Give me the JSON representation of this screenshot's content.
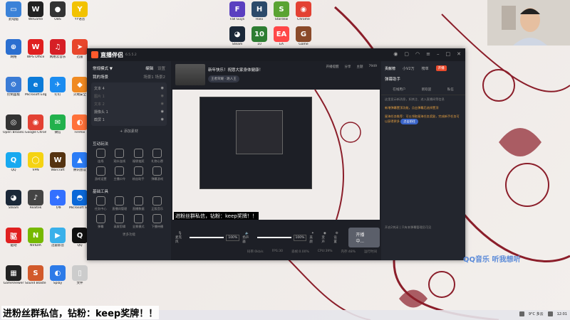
{
  "desktop": {
    "left_icons": [
      {
        "label": "此电脑",
        "color": "#3b82d8",
        "glyph": "▭"
      },
      {
        "label": "WeGame",
        "color": "#222",
        "glyph": "W"
      },
      {
        "label": "OBS",
        "color": "#333",
        "glyph": "●"
      },
      {
        "label": "YY语音",
        "color": "#f2c200",
        "glyph": "Y"
      },
      {
        "label": "网络",
        "color": "#2b6fd0",
        "glyph": "⊕"
      },
      {
        "label": "WPS Office",
        "color": "#e02020",
        "glyph": "W"
      },
      {
        "label": "网易云音乐",
        "color": "#d61f26",
        "glyph": "♫"
      },
      {
        "label": "迅雷",
        "color": "#e8462b",
        "glyph": "➤"
      },
      {
        "label": "控制面板",
        "color": "#3a7bd5",
        "glyph": "⚙"
      },
      {
        "label": "Microsoft Edge",
        "color": "#0c7bd8",
        "glyph": "e"
      },
      {
        "label": "钉钉",
        "color": "#1b8cf0",
        "glyph": "✈"
      },
      {
        "label": "火绒安全",
        "color": "#f08a22",
        "glyph": "◆"
      },
      {
        "label": "Open Broadcaster",
        "color": "#333",
        "glyph": "◎"
      },
      {
        "label": "Google Chrome",
        "color": "#e34133",
        "glyph": "◉"
      },
      {
        "label": "微信",
        "color": "#22b14c",
        "glyph": "✉"
      },
      {
        "label": "Firefox",
        "color": "#ff7139",
        "glyph": "◐"
      },
      {
        "label": "QQ",
        "color": "#18a9f0",
        "glyph": "Q"
      },
      {
        "label": "VPN",
        "color": "#f5d312",
        "glyph": "◯"
      },
      {
        "label": "Warcraft",
        "color": "#553311",
        "glyph": "W"
      },
      {
        "label": "腾讯会议",
        "color": "#2b7cf6",
        "glyph": "▲"
      },
      {
        "label": "Steam",
        "color": "#1b2838",
        "glyph": "◕"
      },
      {
        "label": "Realtek",
        "color": "#444",
        "glyph": "♪"
      },
      {
        "label": "飞书",
        "color": "#3370ff",
        "glyph": "✦"
      },
      {
        "label": "Microsoft Store",
        "color": "#0a68d8",
        "glyph": "◓"
      },
      {
        "label": "驱动",
        "color": "#e02020",
        "glyph": "驱"
      },
      {
        "label": "NVIDIA",
        "color": "#76b900",
        "glyph": "N"
      },
      {
        "label": "迅雷影音",
        "color": "#39b0ea",
        "glyph": "▶"
      },
      {
        "label": "QQ",
        "color": "#111",
        "glyph": "Q"
      },
      {
        "label": "GameViewer",
        "color": "#222",
        "glyph": "▦"
      },
      {
        "label": "Sound Blaster",
        "color": "#d25a2b",
        "glyph": "S"
      },
      {
        "label": "Splay",
        "color": "#2d7be8",
        "glyph": "◐"
      },
      {
        "label": "文件",
        "color": "#ccc",
        "glyph": "▯"
      }
    ],
    "top_icons": [
      {
        "label": "Fall Guys",
        "color": "#5a3fc0",
        "glyph": "F"
      },
      {
        "label": "Halo",
        "color": "#2c4a6a",
        "glyph": "H"
      },
      {
        "label": "Stardew",
        "color": "#5aa332",
        "glyph": "S"
      },
      {
        "label": "Chrome",
        "color": "#e34133",
        "glyph": "◉"
      },
      {
        "label": "Steam",
        "color": "#1b2838",
        "glyph": "◕"
      },
      {
        "label": "10",
        "color": "#2e7d32",
        "glyph": "10"
      },
      {
        "label": "EA",
        "color": "#ff4747",
        "glyph": "EA"
      },
      {
        "label": "Game",
        "color": "#8a4a2a",
        "glyph": "G"
      }
    ]
  },
  "app": {
    "name": "直播伴侣",
    "version": "6.5.5.2",
    "left": {
      "mode_label": "常规模式 ▼",
      "edit_label": "编辑",
      "settings_label": "设置",
      "scenes_title": "我的场景",
      "scene_tabs": "场景1  场景2",
      "sources": [
        {
          "name": "文本 4",
          "dim": false
        },
        {
          "name": "图片 1",
          "dim": true
        },
        {
          "name": "文本 2",
          "dim": true
        },
        {
          "name": "摄像头 1",
          "dim": false
        },
        {
          "name": "截屏 1",
          "dim": false
        }
      ],
      "add_material": "+ 添加素材",
      "interact_title": "互动玩法",
      "interact_items": [
        "连线",
        "观众连线",
        "福袋抽奖",
        "礼物心愿",
        "游戏设置",
        "主播口令",
        "粉丝助手",
        "弹幕游戏"
      ],
      "tools_title": "基础工具",
      "tools_items": [
        "任务中心",
        "直播间管理",
        "直播数据",
        "正版音乐",
        "弹幕",
        "录屏剪辑",
        "全景模式",
        "下播待播"
      ],
      "more_label": "更多功能"
    },
    "center": {
      "stream_title": "新年快乐！祝愿大家身体健康！",
      "stream_tag": "王者荣耀 · 路人王",
      "header_actions": [
        "开播提醒",
        "分享",
        "主题",
        "7949"
      ],
      "marquee": "进粉丝群私信，钻粉：keep奖牌！！",
      "mic_label": "麦克风",
      "speaker_label": "扬声器",
      "mic_pct": "100%",
      "speaker_pct": "100%",
      "mic_level": 1.0,
      "speaker_level": 1.0,
      "ctrl_labels": [
        "美颜",
        "变声",
        "设置"
      ],
      "golive": "开播中...",
      "status": [
        "码率:0kb/s",
        "FPS:30",
        "丢帧:0.00%",
        "CPU:39%",
        "内存:48%",
        "运行时间"
      ]
    },
    "right": {
      "tabs": [
        "贡献榜",
        "小V2万",
        "榜单"
      ],
      "badge": "开播",
      "section": "弹幕助手",
      "subtabs": [
        "在线用户",
        "新欢迎",
        "私信"
      ],
      "texts": [
        "这里显示新消息，如关注、进入直播间等信息",
        "新增弹幕置顶功能，点击弹幕后选择置顶",
        "星海任务推荐：可以领取星海任务奖励，完成新手任务可以获得更多",
        "点击前往"
      ],
      "footer": "开启2关闭 | 只有本弹幕管理员可见"
    }
  },
  "overlay": {
    "lyric": "QQ音乐 听我想听",
    "big_text": "进粉丝群私信，钻粉：keep奖牌！！"
  },
  "taskbar": {
    "weather": "9°C 多云",
    "time": "12:01"
  }
}
